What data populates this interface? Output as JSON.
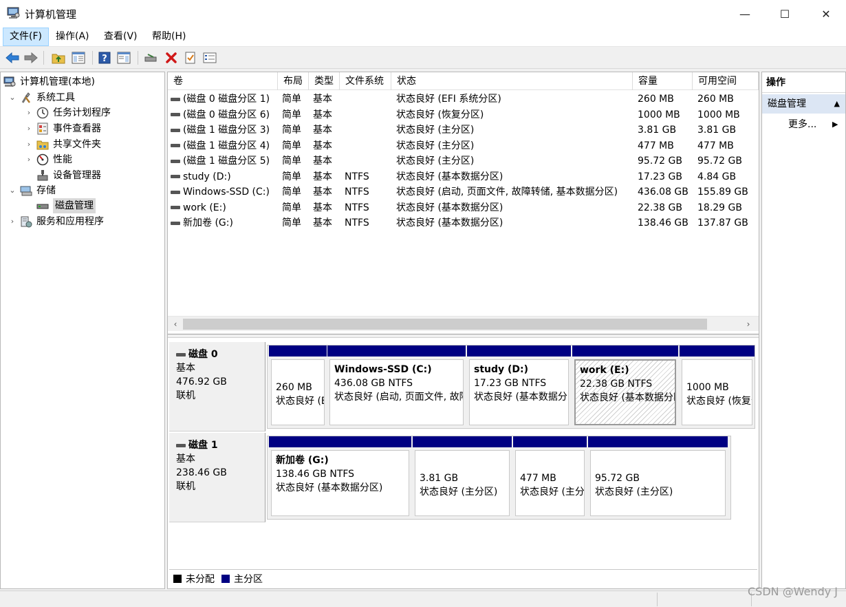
{
  "window": {
    "title": "计算机管理",
    "minimize_glyph": "—",
    "maximize_glyph": "☐",
    "close_glyph": "✕"
  },
  "menu": [
    "文件(F)",
    "操作(A)",
    "查看(V)",
    "帮助(H)"
  ],
  "tree": {
    "root": "计算机管理(本地)",
    "system_tools": "系统工具",
    "task_scheduler": "任务计划程序",
    "event_viewer": "事件查看器",
    "shared_folders": "共享文件夹",
    "performance": "性能",
    "device_manager": "设备管理器",
    "storage": "存储",
    "disk_management": "磁盘管理",
    "services_apps": "服务和应用程序"
  },
  "volume_table": {
    "headers": [
      "卷",
      "布局",
      "类型",
      "文件系统",
      "状态",
      "容量",
      "可用空间"
    ],
    "rows": [
      {
        "vol": "(磁盘 0 磁盘分区 1)",
        "layout": "简单",
        "type": "基本",
        "fs": "",
        "status": "状态良好 (EFI 系统分区)",
        "capacity": "260 MB",
        "free": "260 MB"
      },
      {
        "vol": "(磁盘 0 磁盘分区 6)",
        "layout": "简单",
        "type": "基本",
        "fs": "",
        "status": "状态良好 (恢复分区)",
        "capacity": "1000 MB",
        "free": "1000 MB"
      },
      {
        "vol": "(磁盘 1 磁盘分区 3)",
        "layout": "简单",
        "type": "基本",
        "fs": "",
        "status": "状态良好 (主分区)",
        "capacity": "3.81 GB",
        "free": "3.81 GB"
      },
      {
        "vol": "(磁盘 1 磁盘分区 4)",
        "layout": "简单",
        "type": "基本",
        "fs": "",
        "status": "状态良好 (主分区)",
        "capacity": "477 MB",
        "free": "477 MB"
      },
      {
        "vol": "(磁盘 1 磁盘分区 5)",
        "layout": "简单",
        "type": "基本",
        "fs": "",
        "status": "状态良好 (主分区)",
        "capacity": "95.72 GB",
        "free": "95.72 GB"
      },
      {
        "vol": "study (D:)",
        "layout": "简单",
        "type": "基本",
        "fs": "NTFS",
        "status": "状态良好 (基本数据分区)",
        "capacity": "17.23 GB",
        "free": "4.84 GB"
      },
      {
        "vol": "Windows-SSD (C:)",
        "layout": "简单",
        "type": "基本",
        "fs": "NTFS",
        "status": "状态良好 (启动, 页面文件, 故障转储, 基本数据分区)",
        "capacity": "436.08 GB",
        "free": "155.89 GB"
      },
      {
        "vol": "work (E:)",
        "layout": "简单",
        "type": "基本",
        "fs": "NTFS",
        "status": "状态良好 (基本数据分区)",
        "capacity": "22.38 GB",
        "free": "18.29 GB"
      },
      {
        "vol": "新加卷 (G:)",
        "layout": "简单",
        "type": "基本",
        "fs": "NTFS",
        "status": "状态良好 (基本数据分区)",
        "capacity": "138.46 GB",
        "free": "137.87 GB"
      }
    ]
  },
  "scroll": {
    "left": "‹",
    "right": "›"
  },
  "disk0": {
    "name": "磁盘 0",
    "type": "基本",
    "size": "476.92 GB",
    "state": "联机",
    "partitions": [
      {
        "name": "",
        "size": "260 MB",
        "status": "状态良好 (EFI 系统分区)"
      },
      {
        "name": "Windows-SSD  (C:)",
        "size": "436.08 GB NTFS",
        "status": "状态良好 (启动, 页面文件, 故障转储, 基本数据分区)"
      },
      {
        "name": "study  (D:)",
        "size": "17.23 GB NTFS",
        "status": "状态良好 (基本数据分区)"
      },
      {
        "name": "work  (E:)",
        "size": "22.38 GB NTFS",
        "status": "状态良好 (基本数据分区)"
      },
      {
        "name": "",
        "size": "1000 MB",
        "status": "状态良好 (恢复分区)"
      }
    ]
  },
  "disk1": {
    "name": "磁盘 1",
    "type": "基本",
    "size": "238.46 GB",
    "state": "联机",
    "partitions": [
      {
        "name": "新加卷  (G:)",
        "size": "138.46 GB NTFS",
        "status": "状态良好 (基本数据分区)"
      },
      {
        "name": "",
        "size": "3.81 GB",
        "status": "状态良好 (主分区)"
      },
      {
        "name": "",
        "size": "477 MB",
        "status": "状态良好 (主分区)"
      },
      {
        "name": "",
        "size": "95.72 GB",
        "status": "状态良好 (主分区)"
      }
    ]
  },
  "legend": [
    {
      "label": "未分配",
      "color": "#000000"
    },
    {
      "label": "主分区",
      "color": "#000082"
    }
  ],
  "actions": {
    "header": "操作",
    "section": "磁盘管理",
    "section_arrow": "▲",
    "more": "更多...",
    "more_arrow": "▶"
  },
  "watermark": "CSDN @Wendy J"
}
